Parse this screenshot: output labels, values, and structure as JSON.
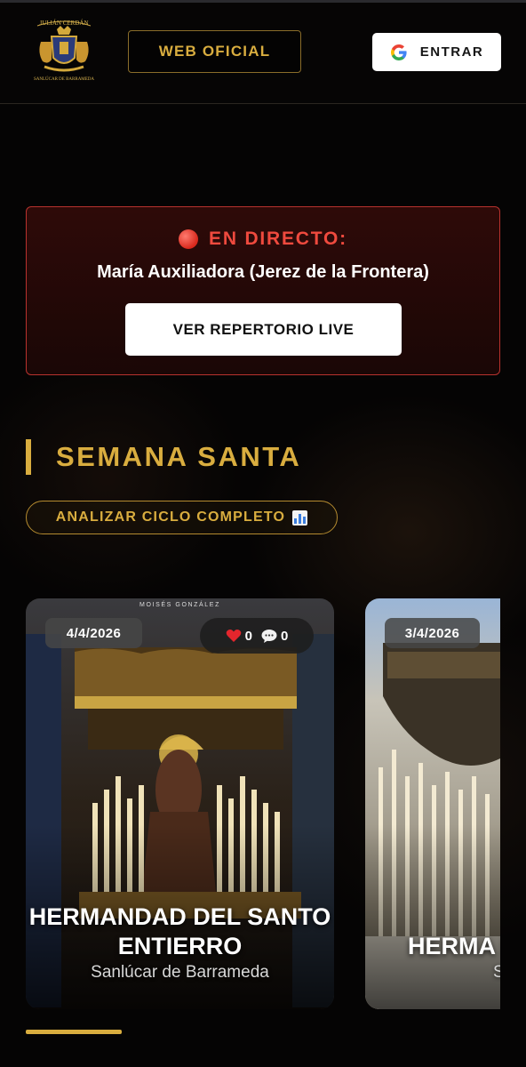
{
  "header": {
    "logo_text_top": "JULIÁN CERDÁN",
    "logo_text_bottom": "SANLÚCAR DE BARRAMEDA",
    "web_label": "WEB OFICIAL",
    "login_label": "ENTRAR"
  },
  "live": {
    "title": "EN DIRECTO:",
    "subtitle": "María Auxiliadora (Jerez de la Frontera)",
    "button_label": "VER REPERTORIO LIVE"
  },
  "section": {
    "title": "SEMANA SANTA",
    "analyze_label": "ANALIZAR CICLO COMPLETO"
  },
  "cards": [
    {
      "date": "4/4/2026",
      "likes": "0",
      "comments": "0",
      "credit": "MOISÉS GONZÁLEZ",
      "name": "HERMANDAD DEL SANTO ENTIERRO",
      "place": "Sanlúcar de Barrameda"
    },
    {
      "date": "3/4/2026",
      "name": "HERMA LA CA",
      "place": "S"
    }
  ],
  "colors": {
    "gold": "#d9ad3f",
    "live_red": "#ef4a3e",
    "background": "#050404"
  },
  "icons": {
    "login": "google-icon",
    "live": "red-circle-icon",
    "analyze": "bar-chart-icon",
    "likes": "heart-icon",
    "comments": "speech-bubble-icon"
  }
}
